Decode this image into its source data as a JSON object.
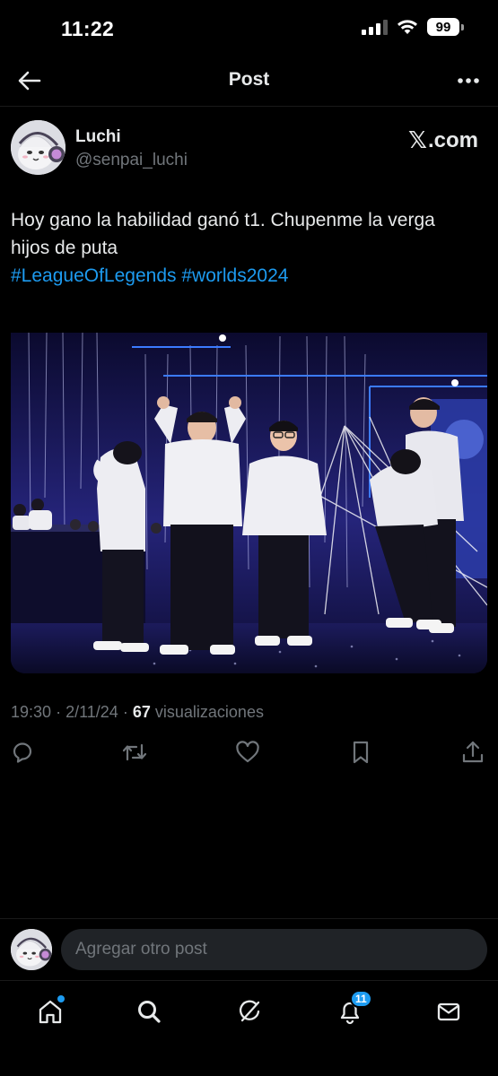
{
  "status_bar": {
    "time": "11:22",
    "battery": "99"
  },
  "header": {
    "title": "Post"
  },
  "author": {
    "name": "Luchi",
    "handle": "@senpai_luchi",
    "source": ".com"
  },
  "tweet": {
    "line1": "Hoy gano la habilidad ganó t1. Chupenme la verga",
    "line2": "hijos de puta",
    "hashtags": [
      "#LeagueOfLegends",
      "#worlds2024"
    ]
  },
  "meta": {
    "time": "19:30",
    "date": "2/11/24",
    "views": "67",
    "views_label": "visualizaciones",
    "separator": "·"
  },
  "reply": {
    "placeholder": "Agregar otro post"
  },
  "nav": {
    "notifications_count": "11"
  },
  "colors": {
    "accent": "#1d9bf0",
    "background": "#000000",
    "text": "#e7e9ea",
    "muted": "#71767b"
  },
  "icons": {
    "actions": [
      "reply-icon",
      "repost-icon",
      "like-icon",
      "bookmark-icon",
      "share-icon"
    ],
    "nav": [
      "home-icon",
      "search-icon",
      "grok-icon",
      "notifications-icon",
      "messages-icon"
    ]
  }
}
